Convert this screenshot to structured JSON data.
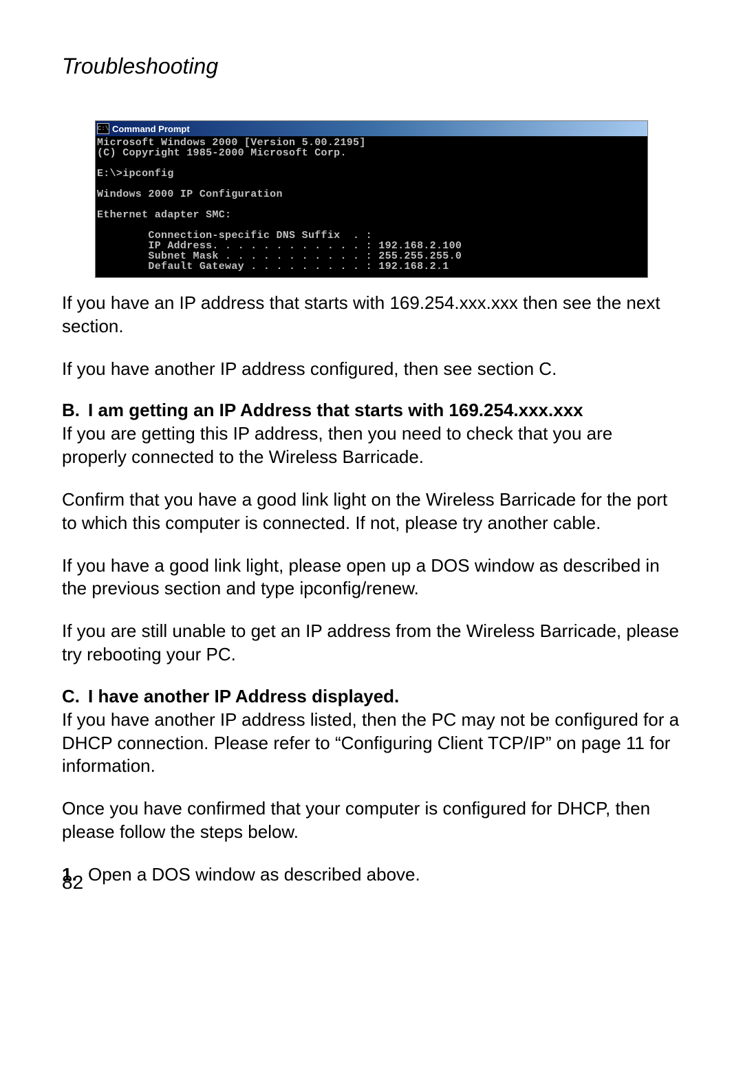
{
  "header": "Troubleshooting",
  "cmd": {
    "title": "Command Prompt",
    "icon_glyph": "C:\\",
    "body": "Microsoft Windows 2000 [Version 5.00.2195]\n(C) Copyright 1985-2000 Microsoft Corp.\n\nE:\\>ipconfig\n\nWindows 2000 IP Configuration\n\nEthernet adapter SMC:\n\n        Connection-specific DNS Suffix  . :\n        IP Address. . . . . . . . . . . . : 192.168.2.100\n        Subnet Mask . . . . . . . . . . . : 255.255.255.0\n        Default Gateway . . . . . . . . . : 192.168.2.1"
  },
  "p1": "If you have an IP address that starts with 169.254.xxx.xxx then see the next section.",
  "p2": "If you have another IP address configured, then see section C.",
  "secB": {
    "marker": "B.",
    "title": "I am getting an IP Address that starts with 169.254.xxx.xxx",
    "p1": "If you are getting this IP address, then you need to check that you are properly connected to the Wireless Barricade.",
    "p2": "Confirm that you have a good link light on the Wireless Barricade for the port to which this computer is connected. If not, please try another cable.",
    "p3": "If you have a good link light, please open up a DOS window as described in the previous section and type ipconfig/renew.",
    "p4": "If you are still unable to get an IP address from the Wireless Barricade, please try rebooting your PC."
  },
  "secC": {
    "marker": "C.",
    "title": "I have another IP Address displayed.",
    "p1": "If you have another IP address listed, then the PC may not be configured for a DHCP connection. Please refer to “Configuring Client TCP/IP” on page 11 for information.",
    "p2": "Once you have confirmed that your computer is configured for DHCP, then please follow the steps below.",
    "step1_num": "1.",
    "step1_text": "Open a DOS window as described above."
  },
  "pageNumber": "82"
}
